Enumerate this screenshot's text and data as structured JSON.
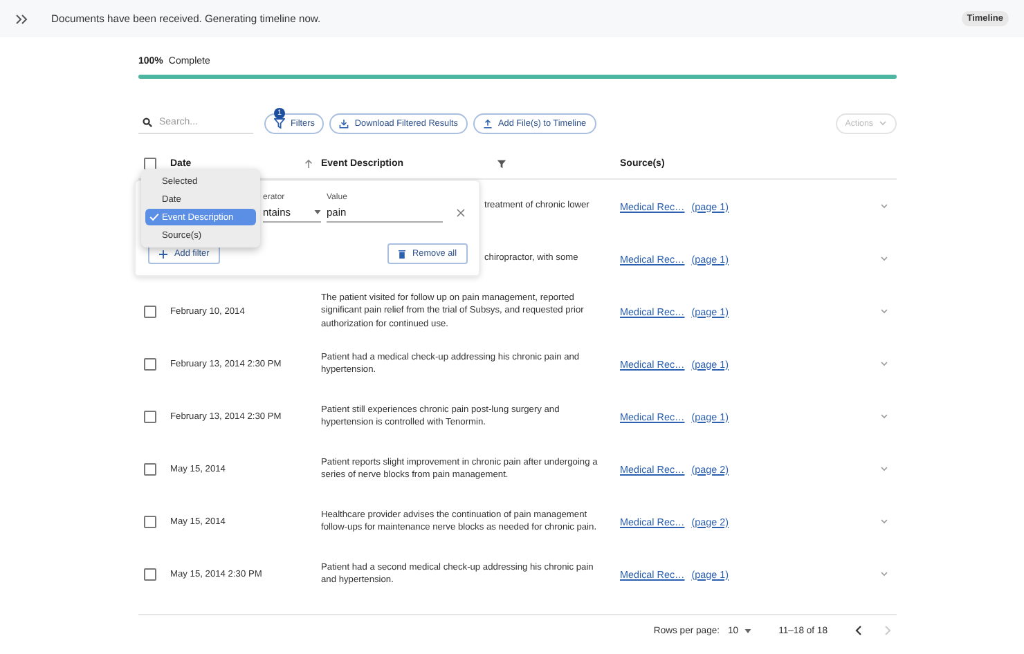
{
  "top_bar": {
    "message": "Documents have been received. Generating timeline now.",
    "badge": "Timeline"
  },
  "progress": {
    "percent": "100%",
    "label": "Complete",
    "level": 1
  },
  "toolbar": {
    "search_placeholder": "Search...",
    "filters": {
      "label": "Filters",
      "count": "1"
    },
    "buttons": [
      {
        "label": "Download Filtered Results",
        "kind": "download"
      },
      {
        "label": "Add File(s) to Timeline",
        "kind": "upload"
      }
    ],
    "actions": {
      "label": "Actions",
      "disabled": true
    }
  },
  "table": {
    "all_checked": false,
    "columns": [
      {
        "label": "Date",
        "kind": "sort"
      },
      {
        "label": "Event Description",
        "kind": "filter"
      },
      {
        "label": "Source(s)",
        "kind": "plain"
      }
    ],
    "rows": [
      {
        "covered": true,
        "description": "treatment of chronic lower",
        "source": "Medical Rec…",
        "page": "(page 1)"
      },
      {
        "covered": true,
        "description": "chiropractor, with some",
        "source": "Medical Rec…",
        "page": "(page 1)"
      },
      {
        "covered": false,
        "checked": false,
        "date": "February 10, 2014",
        "description": "The patient visited for follow up on pain management, reported significant pain relief from the trial of Subsys, and requested prior authorization for continued use.",
        "source": "Medical Rec…",
        "page": "(page 1)"
      },
      {
        "covered": false,
        "checked": false,
        "date": "February 13, 2014 2:30 PM",
        "description": "Patient had a medical check-up addressing his chronic pain and hypertension.",
        "source": "Medical Rec…",
        "page": "(page 1)"
      },
      {
        "covered": false,
        "checked": false,
        "date": "February 13, 2014 2:30 PM",
        "description": "Patient still experiences chronic pain post-lung surgery and hypertension is controlled with Tenormin.",
        "source": "Medical Rec…",
        "page": "(page 1)"
      },
      {
        "covered": false,
        "checked": false,
        "date": "May 15, 2014",
        "description": "Patient reports slight improvement in chronic pain after undergoing a series of nerve blocks from pain management.",
        "source": "Medical Rec…",
        "page": "(page 2)"
      },
      {
        "covered": false,
        "checked": false,
        "date": "May 15, 2014",
        "description": "Healthcare provider advises the continuation of pain management follow-ups for maintenance nerve blocks as needed for chronic pain.",
        "source": "Medical Rec…",
        "page": "(page 2)"
      },
      {
        "covered": false,
        "checked": false,
        "date": "May 15, 2014 2:30 PM",
        "description": "Patient had a second medical check-up addressing his chronic pain and hypertension.",
        "source": "Medical Rec…",
        "page": "(page 1)"
      }
    ]
  },
  "filter_panel": {
    "operator_label": "erator",
    "operator_value": "ntains",
    "value_label": "Value",
    "value": "pain",
    "add_label": "Add filter",
    "remove_label": "Remove all"
  },
  "column_menu": {
    "items": [
      {
        "label": "Selected",
        "selected": false
      },
      {
        "label": "Date",
        "selected": false
      },
      {
        "label": "Event Description",
        "selected": true
      },
      {
        "label": "Source(s)",
        "selected": false
      }
    ]
  },
  "pagination": {
    "rows_label": "Rows per page:",
    "rows_value": "10",
    "range": "11–18 of 18",
    "prev_disabled": false,
    "next_disabled": true
  }
}
